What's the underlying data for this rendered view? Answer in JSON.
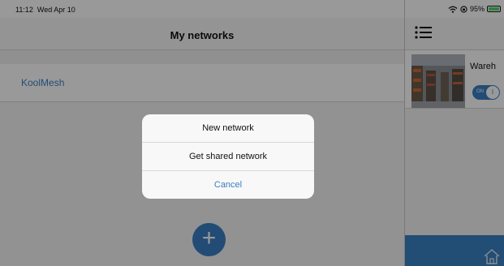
{
  "status_bar": {
    "time": "11:12",
    "date": "Wed Apr 10",
    "battery_percent": "95%",
    "battery_level": 0.95
  },
  "left_pane": {
    "title": "My networks",
    "networks": [
      {
        "label": "KoolMesh"
      }
    ],
    "fab_label": "+"
  },
  "right_pane": {
    "menu_icon": "hamburger-menu-icon",
    "card": {
      "title": "Wareh",
      "toggle_on_label": "ON",
      "toggle_knob_label": "I"
    },
    "tab_icon": "home-icon",
    "tab_color": "#3a80c1"
  },
  "action_sheet": {
    "items": [
      {
        "label": "New network"
      },
      {
        "label": "Get shared network"
      }
    ],
    "cancel_label": "Cancel"
  },
  "colors": {
    "accent": "#3a80c1",
    "overlay": "rgba(0,0,0,0.4)"
  }
}
